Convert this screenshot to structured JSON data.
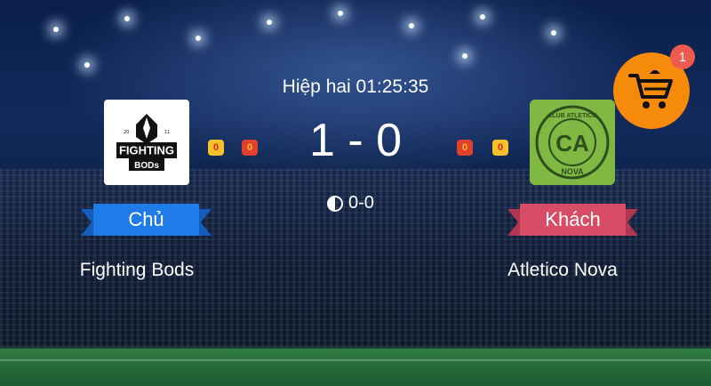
{
  "match": {
    "period_time": "Hiệp hai 01:25:35",
    "score": "1 - 0",
    "half_time_score": "0-0"
  },
  "home": {
    "logo_alt": "Fighting Bods",
    "logo_year_left": "20",
    "logo_year_right": "11",
    "logo_word1": "FIGHTING",
    "logo_word2": "BODs",
    "cards": {
      "yellow": "0",
      "red": "0"
    },
    "role_label": "Chủ",
    "name": "Fighting Bods"
  },
  "away": {
    "logo_alt": "Atletico Nova",
    "logo_arc_top": "CLUB ATLETICO",
    "logo_initials": "CA",
    "logo_arc_bottom": "NOVA",
    "cards": {
      "red": "0",
      "yellow": "0"
    },
    "role_label": "Khách",
    "name": "Atletico Nova"
  },
  "cart": {
    "badge_count": "1",
    "icon": "shopping-cart-icon"
  },
  "colors": {
    "home_ribbon": "#1f7be8",
    "away_ribbon": "#d84c66",
    "cart": "#f58a0b",
    "badge": "#ee5b4e",
    "yellow_card": "#f6c12a",
    "red_card": "#e2402f"
  }
}
